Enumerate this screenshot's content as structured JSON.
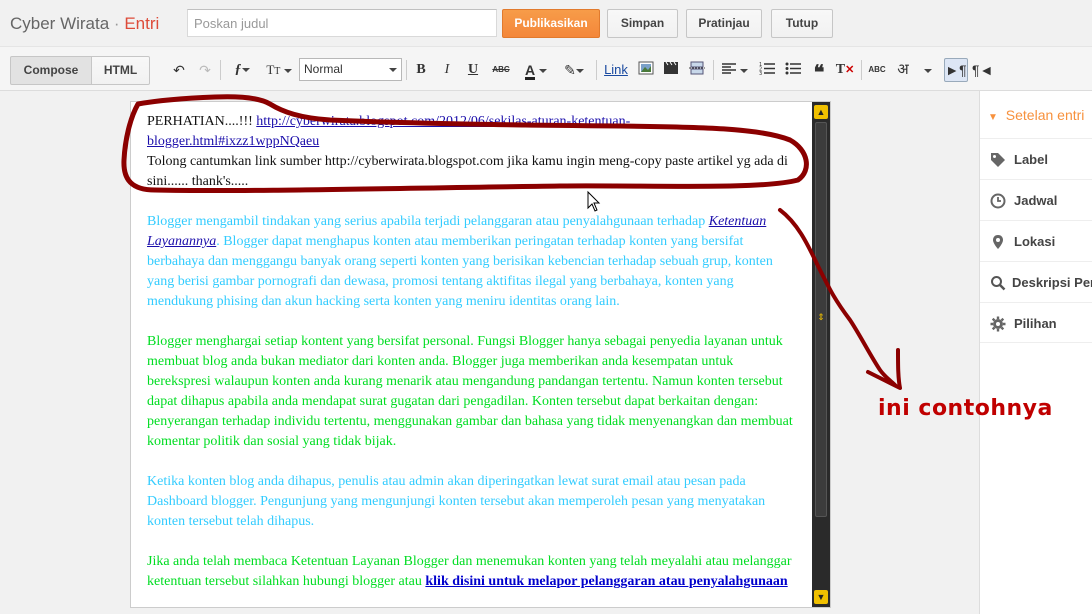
{
  "header": {
    "app_title": "Cyber Wirata",
    "separator": "·",
    "section": "Entri",
    "post_title_placeholder": "Poskan judul",
    "publish_label": "Publikasikan",
    "save_label": "Simpan",
    "preview_label": "Pratinjau",
    "close_label": "Tutup"
  },
  "toolbar": {
    "compose_label": "Compose",
    "html_label": "HTML",
    "font_size_value": "Normal",
    "link_label": "Link",
    "hindi_label": "अ"
  },
  "editor": {
    "notice_prefix": "PERHATIAN....!!! ",
    "notice_link": "http://cyberwirata.blogspot.com/2012/06/sekilas-aturan-ketentuan-blogger.html#ixzz1wppNQaeu",
    "notice_body": "Tolong cantumkan link sumber http://cyberwirata.blogspot.com jika kamu ingin meng-copy paste artikel yg ada di sini...... thank's.....",
    "p1_start": "Blogger mengambil tindakan yang serius apabila terjadi pelanggaran atau penyalahgunaan terhadap ",
    "p1_link": "Ketentuan Layanannya",
    "p1_end": ". Blogger dapat menghapus konten atau memberikan peringatan terhadap konten yang bersifat berbahaya dan menggangu banyak orang seperti konten yang berisikan kebencian terhadap sebuah grup, konten yang berisi gambar pornografi dan dewasa, promosi tentang aktifitas ilegal yang berbahaya, konten yang mendukung phising dan akun hacking serta konten yang meniru identitas orang lain.",
    "p2": "Blogger menghargai setiap kontent yang bersifat personal. Fungsi Blogger hanya sebagai penyedia layanan untuk membuat blog anda bukan mediator dari konten anda. Blogger juga memberikan anda kesempatan untuk berekspresi walaupun konten anda kurang menarik atau mengandung pandangan tertentu. Namun konten tersebut dapat dihapus apabila anda mendapat surat gugatan dari pengadilan. Konten tersebut dapat berkaitan dengan: penyerangan terhadap individu tertentu, menggunakan gambar dan bahasa yang tidak menyenangkan dan membuat komentar politik dan sosial yang tidak bijak.",
    "p3": "Ketika konten blog anda dihapus, penulis atau admin akan diperingatkan lewat surat email atau pesan pada Dashboard blogger. Pengunjung yang mengunjungi konten tersebut akan memperoleh pesan yang menyatakan konten tersebut telah dihapus.",
    "p4_start": "Jika anda telah membaca Ketentuan Layanan Blogger dan menemukan konten yang telah meyalahi atau melanggar ketentuan tersebut silahkan hubungi blogger atau  ",
    "p4_link": "klik disini untuk melapor pelanggaran atau penyalahgunaan"
  },
  "sidebar": {
    "title": "Setelan entri",
    "items": [
      {
        "label": "Label",
        "icon": "tag-icon"
      },
      {
        "label": "Jadwal",
        "icon": "clock-icon"
      },
      {
        "label": "Lokasi",
        "icon": "pin-icon"
      },
      {
        "label": "Deskripsi Penelusuran",
        "icon": "search-icon"
      },
      {
        "label": "Pilihan",
        "icon": "gear-icon"
      }
    ]
  },
  "annotation": {
    "text": "ini contohnya",
    "color": "#c00000"
  },
  "colors": {
    "publish": "#f4873a",
    "cyan_text": "#33ccff",
    "green_text": "#00dd22",
    "link": "#1a0dab"
  }
}
